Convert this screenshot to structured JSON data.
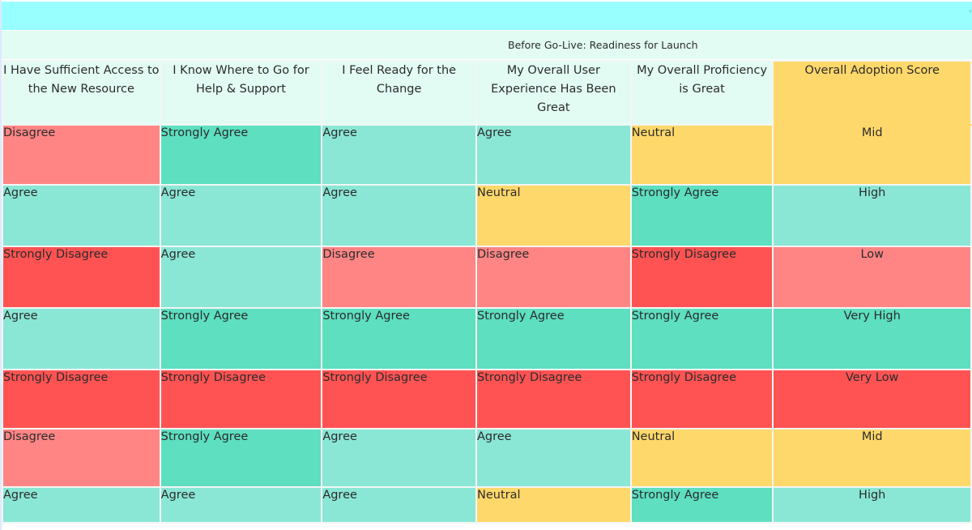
{
  "topbar": {
    "menu_caret": "˅"
  },
  "section_title": "Before Go-Live: Readiness for Launch",
  "colors": {
    "Strongly Agree": "#5ddfc0",
    "Agree": "#8ae7d5",
    "Neutral": "#ffd86b",
    "Disagree": "#ff8585",
    "Strongly Disagree": "#ff5353",
    "Very High": "#5ddfc0",
    "High": "#8ae7d5",
    "Mid": "#ffd86b",
    "Low": "#ff8585",
    "Very Low": "#ff5353",
    "header_bg": "#e2fcf4",
    "topbar_bg": "#98fefe",
    "score_header_bg": "#ffd86b"
  },
  "table": {
    "headers": [
      "I Have Sufficient Access to the New Resource",
      "I Know Where to Go for Help & Support",
      "I Feel Ready for the Change",
      "My Overall User Experience Has Been Great",
      "My Overall Proficiency is Great",
      "Overall Adoption Score"
    ],
    "rows": [
      [
        "Disagree",
        "Strongly Agree",
        "Agree",
        "Agree",
        "Neutral",
        "Mid"
      ],
      [
        "Agree",
        "Agree",
        "Agree",
        "Neutral",
        "Strongly Agree",
        "High"
      ],
      [
        "Strongly Disagree",
        "Agree",
        "Disagree",
        "Disagree",
        "Strongly Disagree",
        "Low"
      ],
      [
        "Agree",
        "Strongly Agree",
        "Strongly Agree",
        "Strongly Agree",
        "Strongly Agree",
        "Very High"
      ],
      [
        "Strongly Disagree",
        "Strongly Disagree",
        "Strongly Disagree",
        "Strongly Disagree",
        "Strongly Disagree",
        "Very Low"
      ],
      [
        "Disagree",
        "Strongly Agree",
        "Agree",
        "Agree",
        "Neutral",
        "Mid"
      ],
      [
        "Agree",
        "Agree",
        "Agree",
        "Neutral",
        "Strongly Agree",
        "High"
      ]
    ]
  }
}
